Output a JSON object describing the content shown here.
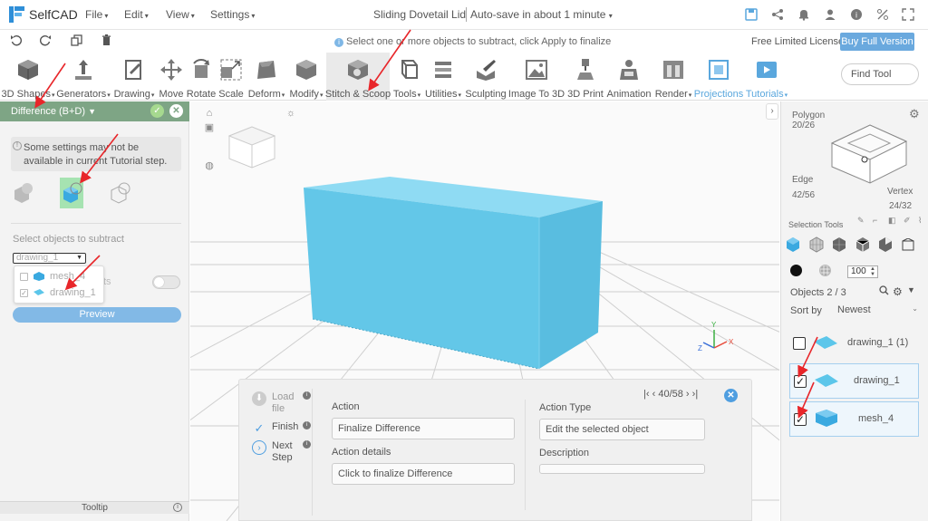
{
  "app": {
    "logo_text": "SelfCAD",
    "menus": [
      "File",
      "Edit",
      "View",
      "Settings"
    ],
    "doc_title": "Sliding Dovetail Lid",
    "autosave": "Auto-save in about 1 minute"
  },
  "infobar": {
    "hint": "Select one or more objects to subtract, click Apply to finalize",
    "license": "Free Limited License",
    "buy_button": "Buy Full Version"
  },
  "toolbar": {
    "tools": [
      {
        "label": "3D Shapes",
        "dropdown": true
      },
      {
        "label": "Generators",
        "dropdown": true
      },
      {
        "label": "Drawing",
        "dropdown": true
      },
      {
        "label": "Move",
        "dropdown": false
      },
      {
        "label": "Rotate",
        "dropdown": false
      },
      {
        "label": "Scale",
        "dropdown": false
      },
      {
        "label": "Deform",
        "dropdown": true
      },
      {
        "label": "Modify",
        "dropdown": true
      },
      {
        "label": "Stitch & Scoop",
        "dropdown": false
      },
      {
        "label": "Tools",
        "dropdown": true
      },
      {
        "label": "Utilities",
        "dropdown": true
      },
      {
        "label": "Sculpting",
        "dropdown": false
      },
      {
        "label": "Image To 3D",
        "dropdown": false
      },
      {
        "label": "3D Print",
        "dropdown": false
      },
      {
        "label": "Animation",
        "dropdown": false
      },
      {
        "label": "Render",
        "dropdown": true
      },
      {
        "label": "Projections",
        "dropdown": false
      },
      {
        "label": "Tutorials",
        "dropdown": true
      }
    ],
    "find_tool": "Find Tool"
  },
  "left_panel": {
    "title": "Difference (B+D)",
    "notice": "Some settings may not be available in current Tutorial step.",
    "select_label": "Select objects to subtract",
    "selected_value": "drawing_1",
    "dropdown_items": [
      {
        "label": "mesh_4",
        "checked": false
      },
      {
        "label": "drawing_1",
        "checked": true
      }
    ],
    "toggle_label": "ts",
    "preview_button": "Preview",
    "tooltip_label": "Tooltip"
  },
  "tutorial": {
    "steps": [
      "Load file",
      "Finish",
      "Next Step"
    ],
    "action_label": "Action",
    "action_value": "Finalize Difference",
    "action_details_label": "Action details",
    "action_details_value": "Click to finalize Difference",
    "action_type_label": "Action Type",
    "action_type_value": "Edit the selected object",
    "description_label": "Description",
    "description_value": "",
    "nav": "40/58"
  },
  "right_panel": {
    "polygon_label": "Polygon",
    "polygon_count": "20/26",
    "edge_label": "Edge",
    "edge_count": "42/56",
    "vertex_label": "Vertex",
    "vertex_count": "24/32",
    "selection_tools_label": "Selection Tools",
    "opacity_value": "100",
    "objects_label": "Objects 2 / 3",
    "sort_label": "Sort by",
    "sort_value": "Newest",
    "objects": [
      {
        "name": "drawing_1 (1)",
        "checked": false,
        "selected": false
      },
      {
        "name": "drawing_1",
        "checked": true,
        "selected": true
      },
      {
        "name": "mesh_4",
        "checked": true,
        "selected": true
      }
    ]
  },
  "colors": {
    "accent": "#5aa7dd",
    "panel_header": "#7ea585",
    "model": "#5cc6ea",
    "annotation": "#e8262a"
  }
}
